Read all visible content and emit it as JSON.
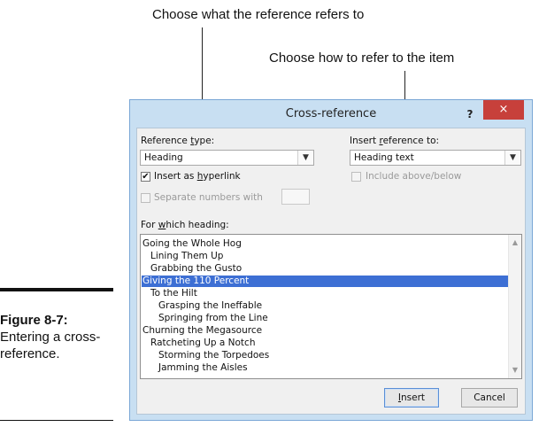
{
  "callouts": {
    "top": "Choose what the reference refers to",
    "second": "Choose how to refer to the item"
  },
  "figure": {
    "number": "Figure 8-7:",
    "caption": "Entering a cross-reference."
  },
  "dialog": {
    "title": "Cross-reference",
    "help": "?",
    "close": "×",
    "reference_type": {
      "label_pre": "Reference ",
      "label_u": "t",
      "label_post": "ype:",
      "value": "Heading"
    },
    "insert_reference_to": {
      "label_pre": "Insert ",
      "label_u": "r",
      "label_post": "eference to:",
      "value": "Heading text"
    },
    "insert_as_hyperlink": {
      "label_pre": "Insert as ",
      "label_u": "h",
      "label_post": "yperlink",
      "checked": true,
      "check_glyph": "✔"
    },
    "include_above_below": {
      "label": "Include above/below",
      "enabled": false
    },
    "separate_numbers_with": {
      "label": "Separate numbers with",
      "enabled": false
    },
    "for_which_heading": {
      "label_pre": "For ",
      "label_u": "w",
      "label_post": "hich heading:"
    },
    "headings": [
      "Going the Whole Hog",
      "Lining Them Up",
      "Grabbing the Gusto",
      "Giving the 110 Percent",
      "To the Hilt",
      "Grasping the Ineffable",
      "Springing from the Line",
      "Churning the Megasource",
      "Ratcheting Up a Notch",
      "Storming the Torpedoes",
      "Jamming the Aisles"
    ],
    "selected_index": 3,
    "buttons": {
      "insert_u": "I",
      "insert_rest": "nsert",
      "cancel": "Cancel"
    },
    "icons": {
      "dropdown": "chevron-down-icon",
      "scroll_up": "chevron-up-icon",
      "scroll_down": "chevron-down-icon"
    }
  }
}
